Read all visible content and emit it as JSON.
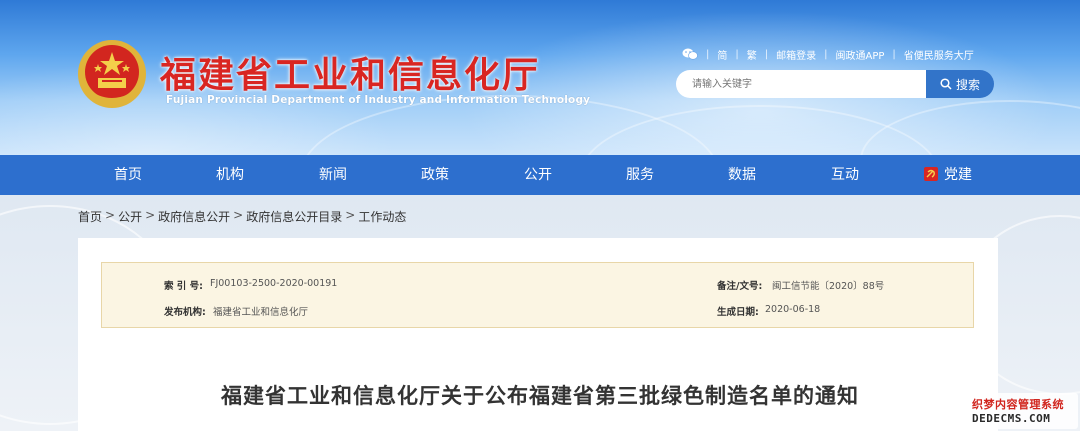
{
  "site": {
    "title": "福建省工业和信息化厅",
    "subtitle": "Fujian Provincial Department of Industry and Information Technology"
  },
  "toplinks": [
    "简",
    "繁",
    "邮箱登录",
    "闽政通APP",
    "省便民服务大厅"
  ],
  "search": {
    "placeholder": "请输入关键字",
    "button_label": "搜索"
  },
  "nav": [
    "首页",
    "机构",
    "新闻",
    "政策",
    "公开",
    "服务",
    "数据",
    "互动",
    "党建"
  ],
  "breadcrumb": [
    "首页",
    "公开",
    "政府信息公开",
    "政府信息公开目录",
    "工作动态"
  ],
  "info": {
    "index_label": "索 引 号:",
    "index_value": "FJ00103-2500-2020-00191",
    "doc_label": "备注/文号:",
    "doc_value": "闽工信节能〔2020〕88号",
    "publisher_label": "发布机构:",
    "publisher_value": "福建省工业和信息化厅",
    "date_label": "生成日期:",
    "date_value": "2020-06-18"
  },
  "article": {
    "title": "福建省工业和信息化厅关于公布福建省第三批绿色制造名单的通知"
  },
  "watermark": {
    "line1": "织梦内容管理系统",
    "line2": "DEDECMS.COM"
  },
  "colors": {
    "nav": "#2d6fce",
    "title_red": "#d92622",
    "search_button": "#3274c9",
    "info_bg": "#fbf5e3"
  }
}
